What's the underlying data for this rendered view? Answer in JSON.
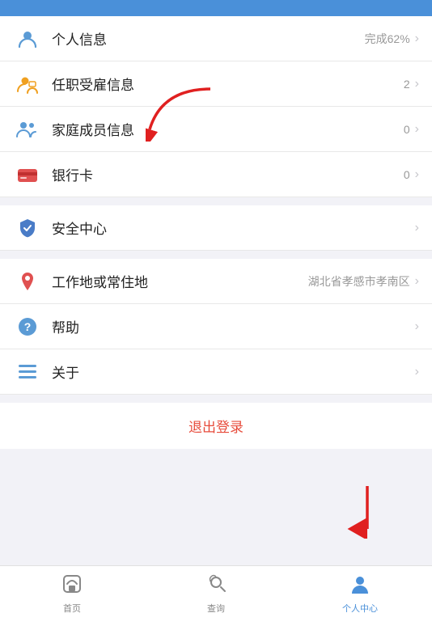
{
  "statusBar": {},
  "menuItems": [
    {
      "id": "personal-info",
      "label": "个人信息",
      "value": "完成62%",
      "iconType": "person",
      "showChevron": true
    },
    {
      "id": "employment-info",
      "label": "任职受雇信息",
      "value": "2",
      "iconType": "employment",
      "showChevron": true
    },
    {
      "id": "family-info",
      "label": "家庭成员信息",
      "value": "0",
      "iconType": "family",
      "showChevron": true
    },
    {
      "id": "bank-card",
      "label": "银行卡",
      "value": "0",
      "iconType": "bank",
      "showChevron": true
    }
  ],
  "menuItems2": [
    {
      "id": "security",
      "label": "安全中心",
      "value": "",
      "iconType": "security",
      "showChevron": true
    }
  ],
  "menuItems3": [
    {
      "id": "work-location",
      "label": "工作地或常住地",
      "value": "湖北省孝感市孝南区",
      "iconType": "location",
      "showChevron": true
    },
    {
      "id": "help",
      "label": "帮助",
      "value": "",
      "iconType": "help",
      "showChevron": true
    },
    {
      "id": "about",
      "label": "关于",
      "value": "",
      "iconType": "about",
      "showChevron": true
    }
  ],
  "logout": {
    "label": "退出登录"
  },
  "tabBar": {
    "tabs": [
      {
        "id": "home",
        "label": "首页",
        "active": false
      },
      {
        "id": "query",
        "label": "查询",
        "active": false
      },
      {
        "id": "profile",
        "label": "个人中心",
        "active": true
      }
    ]
  }
}
